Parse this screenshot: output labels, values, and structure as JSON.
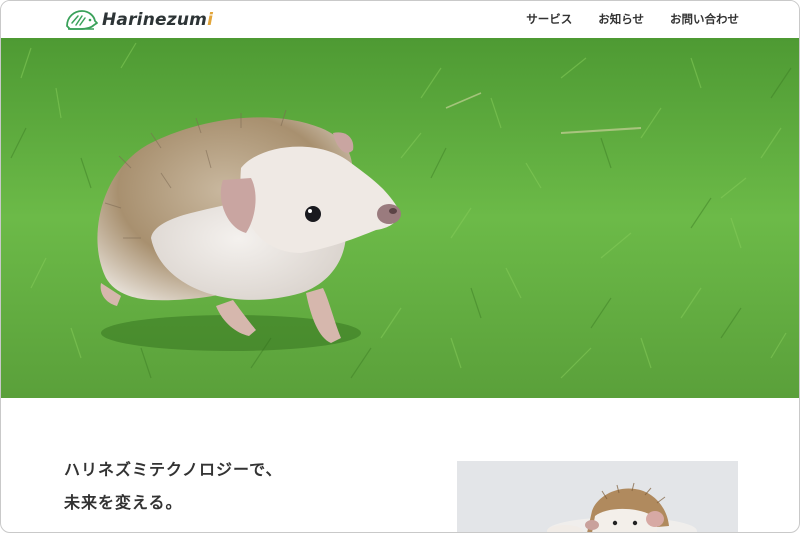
{
  "header": {
    "logo_text_main": "Harinezum",
    "logo_text_accent": "i",
    "logo_icon": "hedgehog-logo-icon",
    "nav": [
      {
        "label": "サービス"
      },
      {
        "label": "お知らせ"
      },
      {
        "label": "お問い合わせ"
      }
    ]
  },
  "hero": {
    "image": "hedgehog-on-grass-photo"
  },
  "intro": {
    "tagline_line1": "ハリネズミテクノロジーで、",
    "tagline_line2": "未来を変える。",
    "photo": "hedgehog-portrait-photo"
  },
  "colors": {
    "grass": "#5aa53c",
    "text": "#333333",
    "logo_green": "#3aa15a"
  }
}
